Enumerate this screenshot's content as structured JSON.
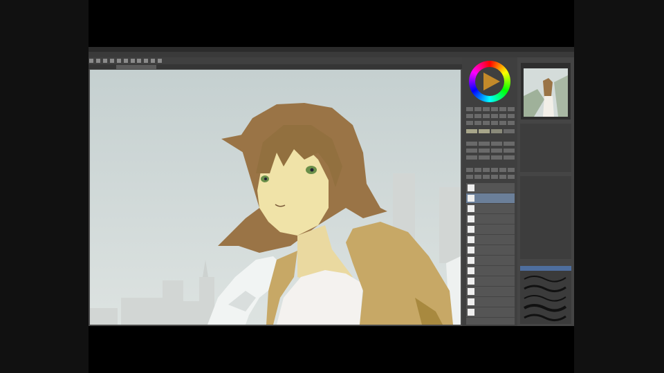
{
  "app": {
    "menu": [
      "",
      "",
      "",
      "",
      "",
      "",
      "",
      "",
      ""
    ],
    "document_tab": "",
    "accent_color": "#4e6e9e",
    "icons": [
      "color-wheel-icon",
      "play-icon",
      "brush-icon",
      "pen-icon",
      "eraser-icon"
    ]
  },
  "palette": {
    "layers": [
      {
        "name": ""
      },
      {
        "name": ""
      },
      {
        "name": ""
      },
      {
        "name": ""
      },
      {
        "name": ""
      },
      {
        "name": ""
      },
      {
        "name": ""
      },
      {
        "name": ""
      },
      {
        "name": ""
      },
      {
        "name": ""
      },
      {
        "name": ""
      },
      {
        "name": ""
      },
      {
        "name": ""
      }
    ]
  },
  "navigator": {
    "title": ""
  }
}
